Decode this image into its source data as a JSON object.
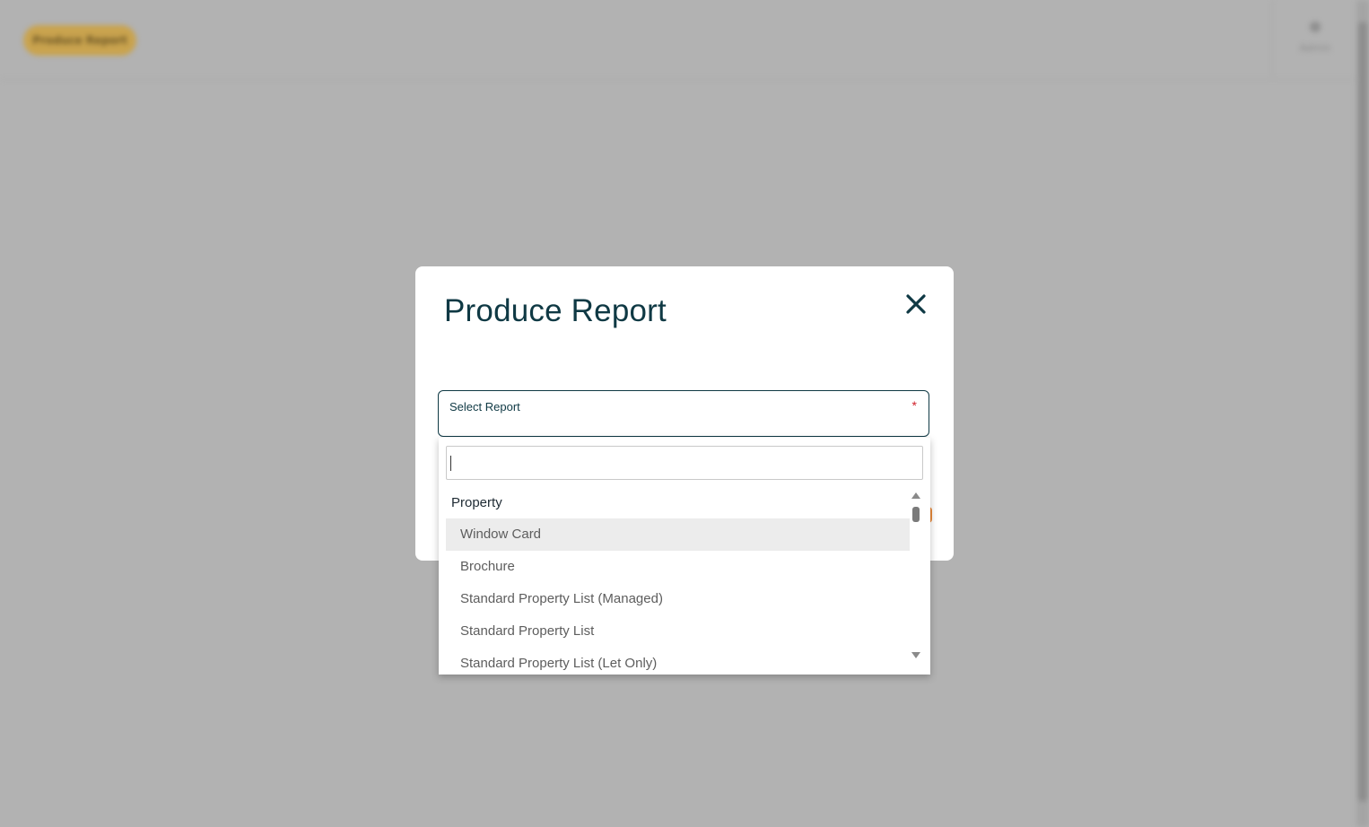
{
  "background": {
    "header_button_label": "Produce Report",
    "user_label": "Admin"
  },
  "modal": {
    "title": "Produce Report",
    "select": {
      "label": "Select Report",
      "required_mark": "*"
    }
  },
  "dropdown": {
    "search_value": "",
    "group": "Property",
    "options": [
      "Window Card",
      "Brochure",
      "Standard Property List (Managed)",
      "Standard Property List",
      "Standard Property List (Let Only)"
    ],
    "highlighted_option": "Window Card"
  },
  "colors": {
    "overlay": "#b2b2b2",
    "title": "#0f3944",
    "required": "#d0202a",
    "highlight": "#ececec",
    "accent_orange": "#e98a3b",
    "header_pill": "#c9a34e"
  },
  "icons": {
    "close": "close-icon",
    "scroll_up": "chevron-up-icon",
    "scroll_down": "chevron-down-icon"
  }
}
